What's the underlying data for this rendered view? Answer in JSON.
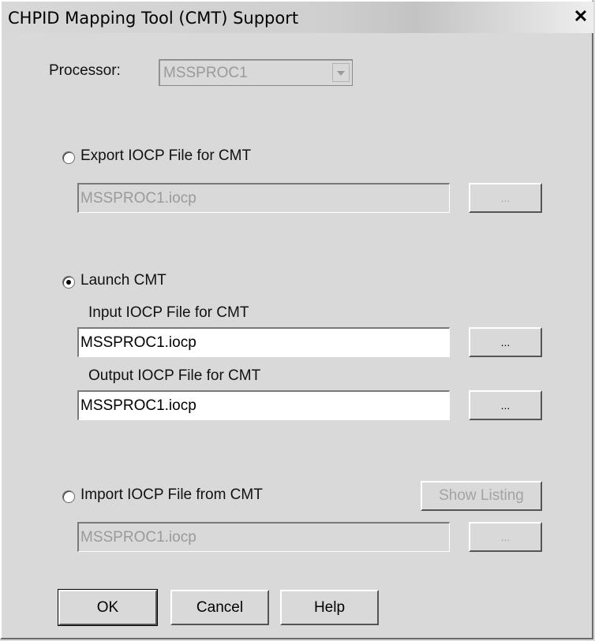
{
  "window": {
    "title": "CHPID Mapping Tool (CMT) Support",
    "close_label": "✕"
  },
  "processor": {
    "label": "Processor:",
    "value": "MSSPROC1"
  },
  "export": {
    "label": "Export IOCP File for CMT",
    "selected": false,
    "file_value": "MSSPROC1.iocp",
    "browse_label": "..."
  },
  "launch": {
    "label": "Launch CMT",
    "selected": true,
    "input_label": "Input  IOCP File for CMT",
    "input_value": "MSSPROC1.iocp",
    "output_label": "Output IOCP File for CMT",
    "output_value": "MSSPROC1.iocp",
    "browse_label": "..."
  },
  "import": {
    "label": "Import IOCP File from CMT",
    "selected": false,
    "show_listing_label": "Show Listing",
    "file_value": "MSSPROC1.iocp",
    "browse_label": "..."
  },
  "buttons": {
    "ok": "OK",
    "cancel": "Cancel",
    "help": "Help"
  }
}
